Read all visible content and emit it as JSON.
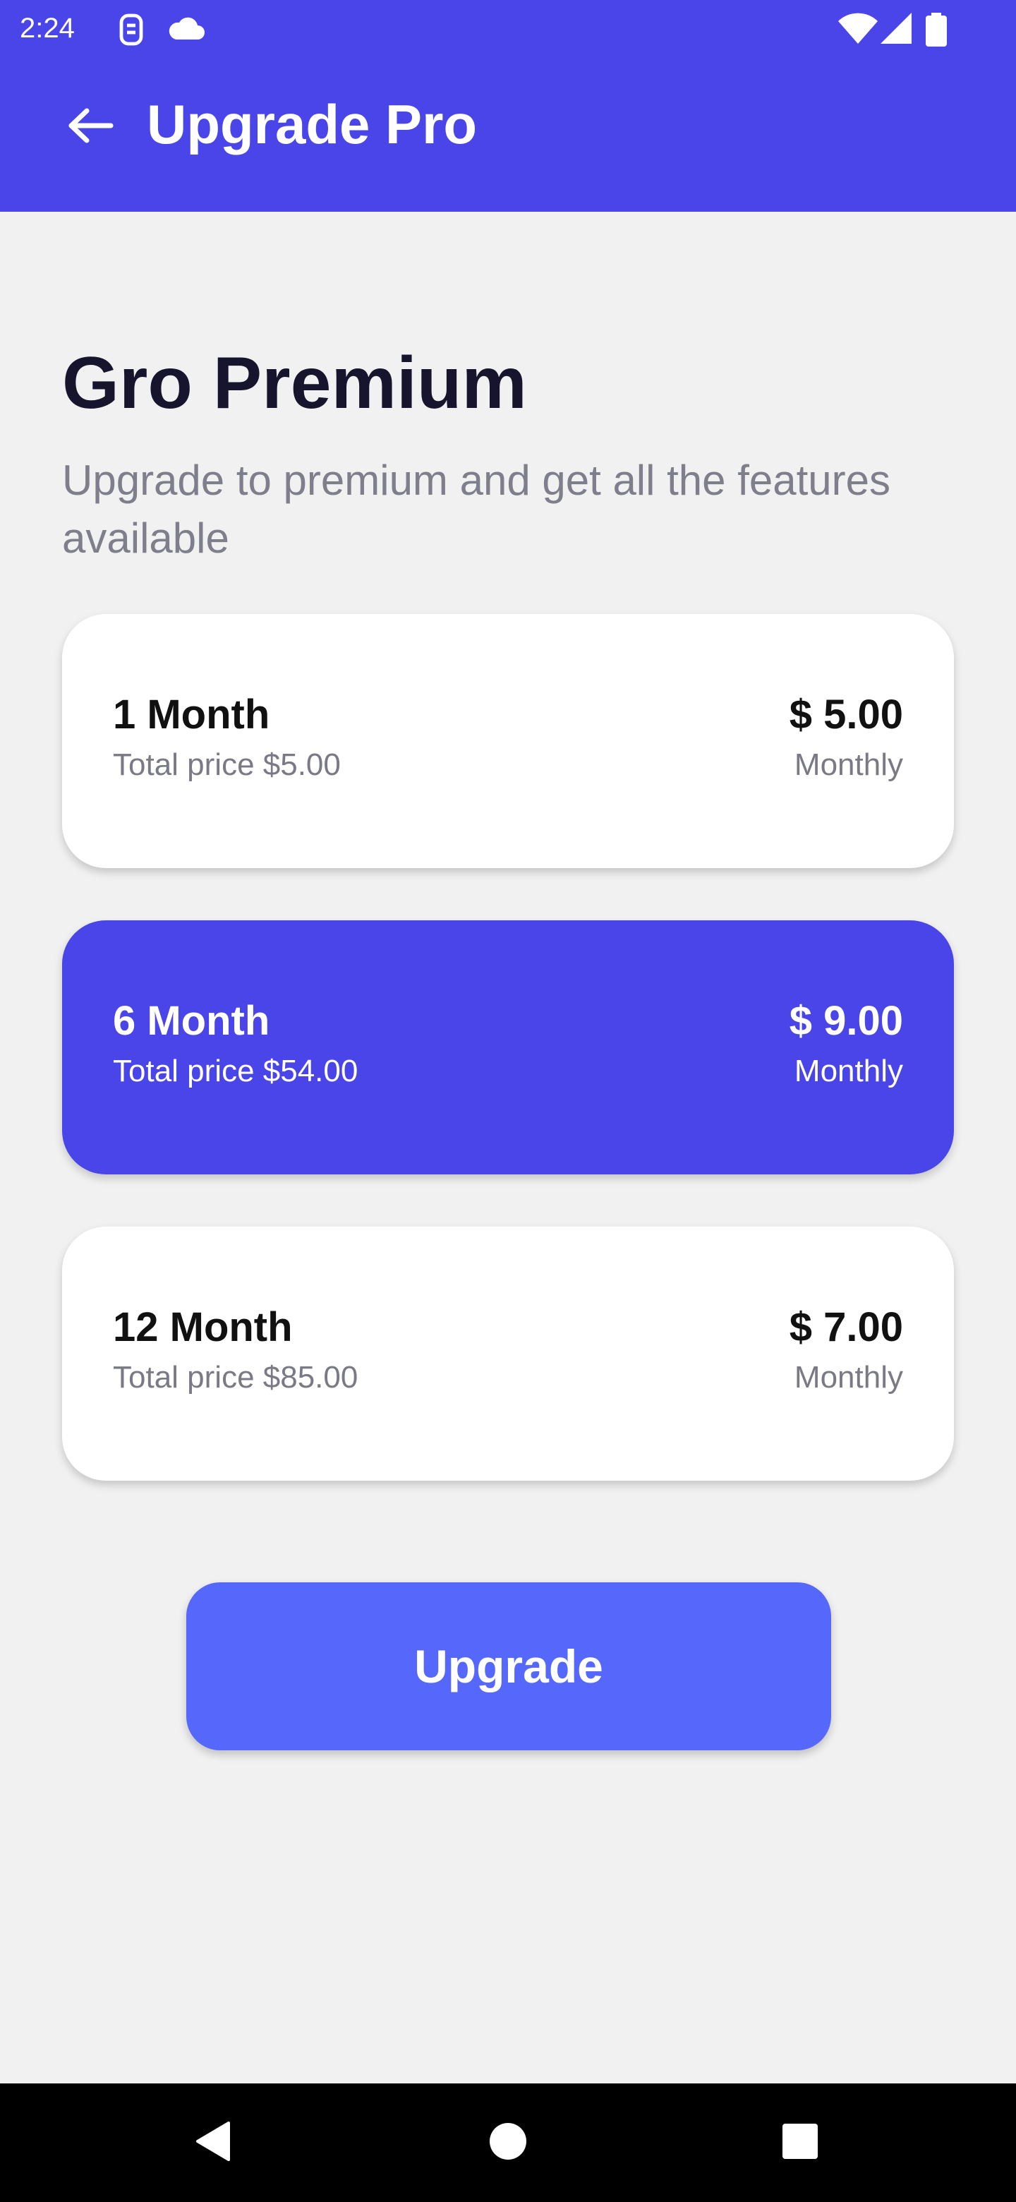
{
  "status_bar": {
    "time": "2:24",
    "icons": [
      "sim-icon",
      "cloud-icon",
      "wifi-icon",
      "signal-icon",
      "battery-icon"
    ]
  },
  "app_bar": {
    "title": "Upgrade Pro",
    "back_icon": "arrow-left-icon",
    "color": "#4a45e8"
  },
  "header": {
    "title": "Gro Premium",
    "subtitle": "Upgrade to premium and get all the features available"
  },
  "plans": [
    {
      "name": "1 Month",
      "total": "Total price $5.00",
      "price": "$ 5.00",
      "period": "Monthly",
      "selected": false
    },
    {
      "name": "6 Month",
      "total": "Total price $54.00",
      "price": "$ 9.00",
      "period": "Monthly",
      "selected": true
    },
    {
      "name": "12 Month",
      "total": "Total price $85.00",
      "price": "$ 7.00",
      "period": "Monthly",
      "selected": false
    }
  ],
  "actions": {
    "upgrade_label": "Upgrade",
    "upgrade_color": "#5668fb"
  },
  "nav_bar": {
    "icons": [
      "back-triangle-icon",
      "home-circle-icon",
      "recents-square-icon"
    ]
  }
}
